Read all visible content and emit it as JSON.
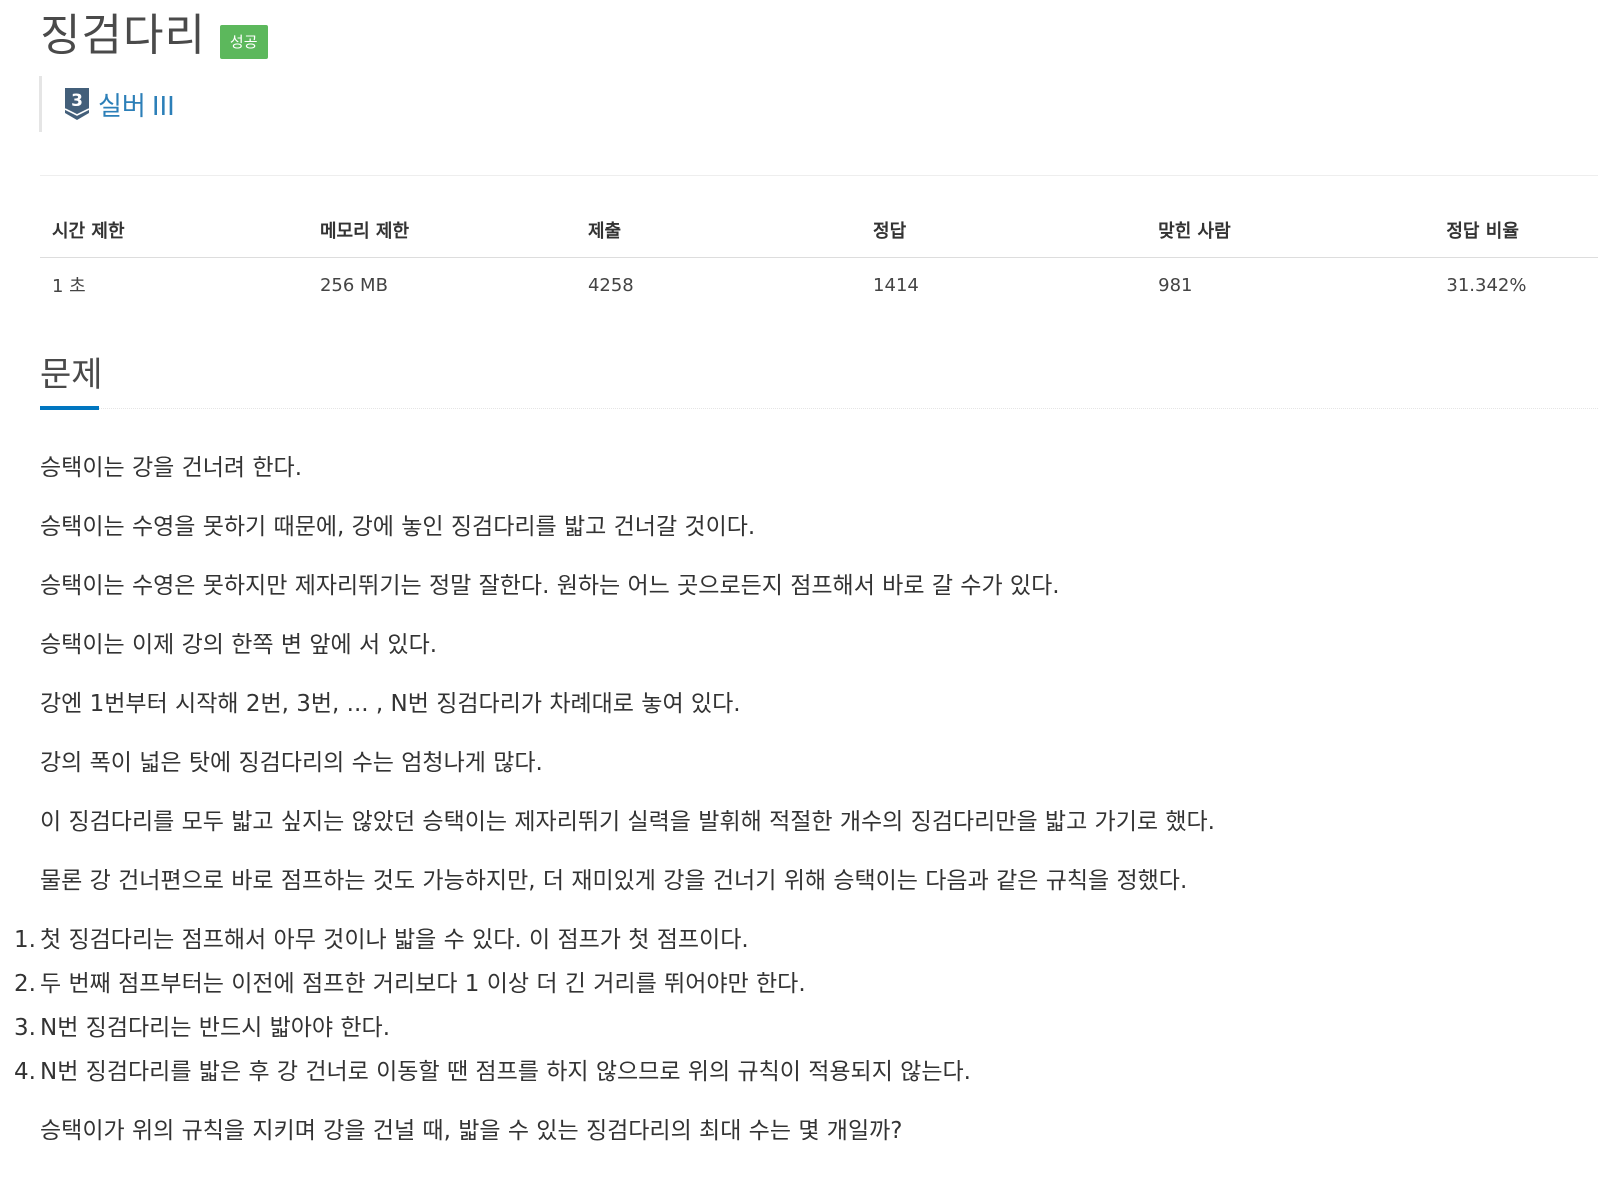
{
  "problem": {
    "title": "징검다리",
    "status_badge": "성공",
    "tier_number": "3",
    "tier_name": "실버",
    "tier_level": "III"
  },
  "stats": {
    "headers": [
      "시간 제한",
      "메모리 제한",
      "제출",
      "정답",
      "맞힌 사람",
      "정답 비율"
    ],
    "values": [
      "1 초",
      "256 MB",
      "4258",
      "1414",
      "981",
      "31.342%"
    ]
  },
  "section": {
    "title": "문제"
  },
  "description": {
    "paragraphs": [
      "승택이는 강을 건너려 한다.",
      "승택이는 수영을 못하기 때문에, 강에 놓인 징검다리를 밟고 건너갈 것이다.",
      "승택이는 수영은 못하지만 제자리뛰기는 정말 잘한다. 원하는 어느 곳으로든지 점프해서 바로 갈 수가 있다.",
      "승택이는 이제 강의 한쪽 변 앞에 서 있다.",
      "강엔 1번부터 시작해 2번, 3번, ... , N번 징검다리가 차례대로 놓여 있다.",
      "강의 폭이 넓은 탓에 징검다리의 수는 엄청나게 많다.",
      "이 징검다리를 모두 밟고 싶지는 않았던 승택이는 제자리뛰기 실력을 발휘해 적절한 개수의 징검다리만을 밟고 가기로 했다.",
      "물론 강 건너편으로 바로 점프하는 것도 가능하지만, 더 재미있게 강을 건너기 위해 승택이는 다음과 같은 규칙을 정했다."
    ],
    "rules": [
      {
        "num": "1.",
        "text": "첫 징검다리는 점프해서 아무 것이나 밟을 수 있다. 이 점프가 첫 점프이다."
      },
      {
        "num": "2.",
        "text": "두 번째 점프부터는 이전에 점프한 거리보다 1 이상 더 긴 거리를 뛰어야만 한다."
      },
      {
        "num": "3.",
        "text": "N번 징검다리는 반드시 밟아야 한다."
      },
      {
        "num": "4.",
        "text": "N번 징검다리를 밟은 후 강 건너로 이동할 땐 점프를 하지 않으므로 위의 규칙이 적용되지 않는다."
      }
    ],
    "question": "승택이가 위의 규칙을 지키며 강을 건널 때, 밟을 수 있는 징검다리의 최대 수는 몇 개일까?"
  },
  "colors": {
    "badge_green": "#5cb85c",
    "tier_blue": "#2c7fb8",
    "tier_icon": "#435f7a",
    "section_underline": "#0076c0"
  }
}
